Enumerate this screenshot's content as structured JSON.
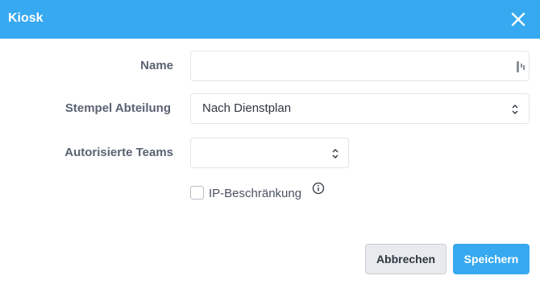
{
  "dialog": {
    "title": "Kiosk",
    "close_icon": "close-icon",
    "accent_color": "#36a9f0"
  },
  "form": {
    "name": {
      "label": "Name",
      "value": "",
      "icon": "keyboard-handle-icon"
    },
    "stempel_abteilung": {
      "label": "Stempel Abteilung",
      "selected": "Nach Dienstplan"
    },
    "autorisierte_teams": {
      "label": "Autorisierte Teams",
      "selected": ""
    },
    "ip_beschraenkung": {
      "label": "IP-Beschränkung",
      "checked": false,
      "icon": "info-icon"
    }
  },
  "footer": {
    "cancel_label": "Abbrechen",
    "save_label": "Speichern"
  }
}
